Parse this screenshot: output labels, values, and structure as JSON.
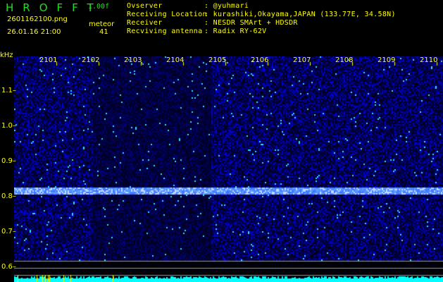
{
  "header": {
    "app_title": "HROFFT",
    "version": "1.00f",
    "filename": "2601162100.png",
    "datetime": "26.01.16 21:00",
    "meteor_label": "meteor",
    "meteor_count": "41",
    "info": [
      {
        "label": "Ovserver",
        "value": ": @yuhmari"
      },
      {
        "label": "Receiving Location",
        "value": ": kurashiki,Okayama,JAPAN (133.77E, 34.58N)"
      },
      {
        "label": "Receiver",
        "value": ": NESDR SMArt + HDSDR"
      },
      {
        "label": "Recviving antenna",
        "value": ": Radix RY-62V"
      }
    ]
  },
  "spectrogram": {
    "y_unit": "kHz",
    "y_ticks": [
      "1.1",
      "1.0",
      "0.9",
      "0.8",
      "0.7",
      "0.6"
    ],
    "y_values": [
      1.1,
      1.0,
      0.9,
      0.8,
      0.7,
      0.6
    ],
    "time_ticks": [
      "2101",
      "2102",
      "2103",
      "2104",
      "2105",
      "2106",
      "2107",
      "2108",
      "2109",
      "2110"
    ],
    "carrier_khz": 0.82,
    "colors": {
      "background": "#000010",
      "signal": "#1a2aff",
      "carrier": "#8fb0ff",
      "count_bar": "#00ffff",
      "axis": "#ffff00"
    }
  }
}
